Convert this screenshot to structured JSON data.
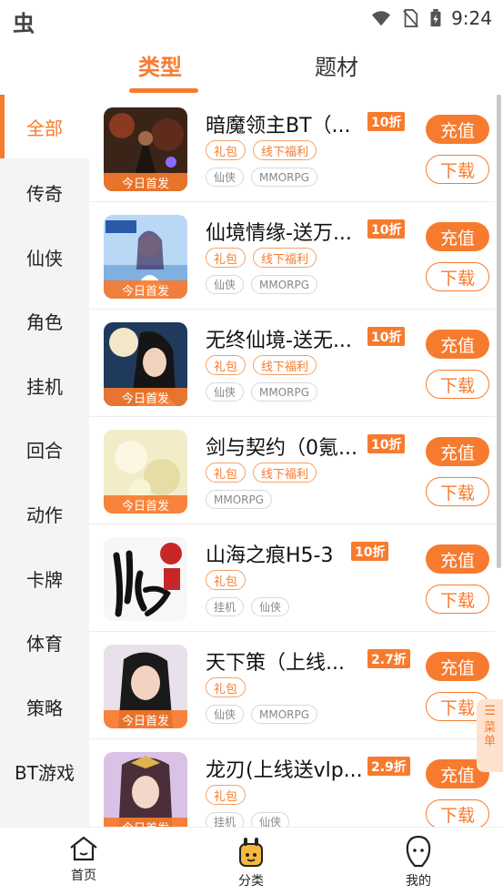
{
  "status_bar": {
    "app_glyph": "虫",
    "time": "9:24",
    "icons": [
      "wifi-icon",
      "no-sim-icon",
      "battery-charging-icon"
    ]
  },
  "top_tabs": [
    {
      "label": "类型",
      "active": true
    },
    {
      "label": "题材",
      "active": false
    }
  ],
  "sidebar": {
    "items": [
      {
        "label": "全部",
        "active": true
      },
      {
        "label": "传奇"
      },
      {
        "label": "仙侠"
      },
      {
        "label": "角色"
      },
      {
        "label": "挂机"
      },
      {
        "label": "回合"
      },
      {
        "label": "动作"
      },
      {
        "label": "卡牌"
      },
      {
        "label": "体育"
      },
      {
        "label": "策略"
      },
      {
        "label": "BT游戏"
      }
    ]
  },
  "first_release_label": "今日首发",
  "buttons": {
    "charge": "充值",
    "download": "下载"
  },
  "games": [
    {
      "title": "暗魔领主BT（...",
      "discount": "10折",
      "tags": [
        "礼包",
        "线下福利"
      ],
      "genres": [
        "仙侠",
        "MMORPG"
      ],
      "first_release": true
    },
    {
      "title": "仙境情缘-送万...",
      "discount": "10折",
      "tags": [
        "礼包",
        "线下福利"
      ],
      "genres": [
        "仙侠",
        "MMORPG"
      ],
      "first_release": true
    },
    {
      "title": "无终仙境-送无...",
      "discount": "10折",
      "tags": [
        "礼包",
        "线下福利"
      ],
      "genres": [
        "仙侠",
        "MMORPG"
      ],
      "first_release": true
    },
    {
      "title": "剑与契约（0氪...",
      "discount": "10折",
      "tags": [
        "礼包",
        "线下福利"
      ],
      "genres": [
        "MMORPG"
      ],
      "first_release": true
    },
    {
      "title": "山海之痕H5-3",
      "discount": "10折",
      "tags": [
        "礼包"
      ],
      "genres": [
        "挂机",
        "仙侠"
      ],
      "first_release": false
    },
    {
      "title": "天下策（上线...",
      "discount": "2.7折",
      "tags": [
        "礼包"
      ],
      "genres": [
        "仙侠",
        "MMORPG"
      ],
      "first_release": true
    },
    {
      "title": "龙刃(上线送vlp...",
      "discount": "2.9折",
      "tags": [
        "礼包"
      ],
      "genres": [
        "挂机",
        "仙侠"
      ],
      "first_release": true
    }
  ],
  "float_menu": {
    "label": "菜单"
  },
  "bottom_nav": [
    {
      "label": "首页",
      "icon": "home-icon"
    },
    {
      "label": "分类",
      "icon": "category-icon",
      "active": true
    },
    {
      "label": "我的",
      "icon": "profile-icon"
    }
  ],
  "colors": {
    "accent": "#f77b2e",
    "sidebar_bg": "#f4f4f4"
  }
}
